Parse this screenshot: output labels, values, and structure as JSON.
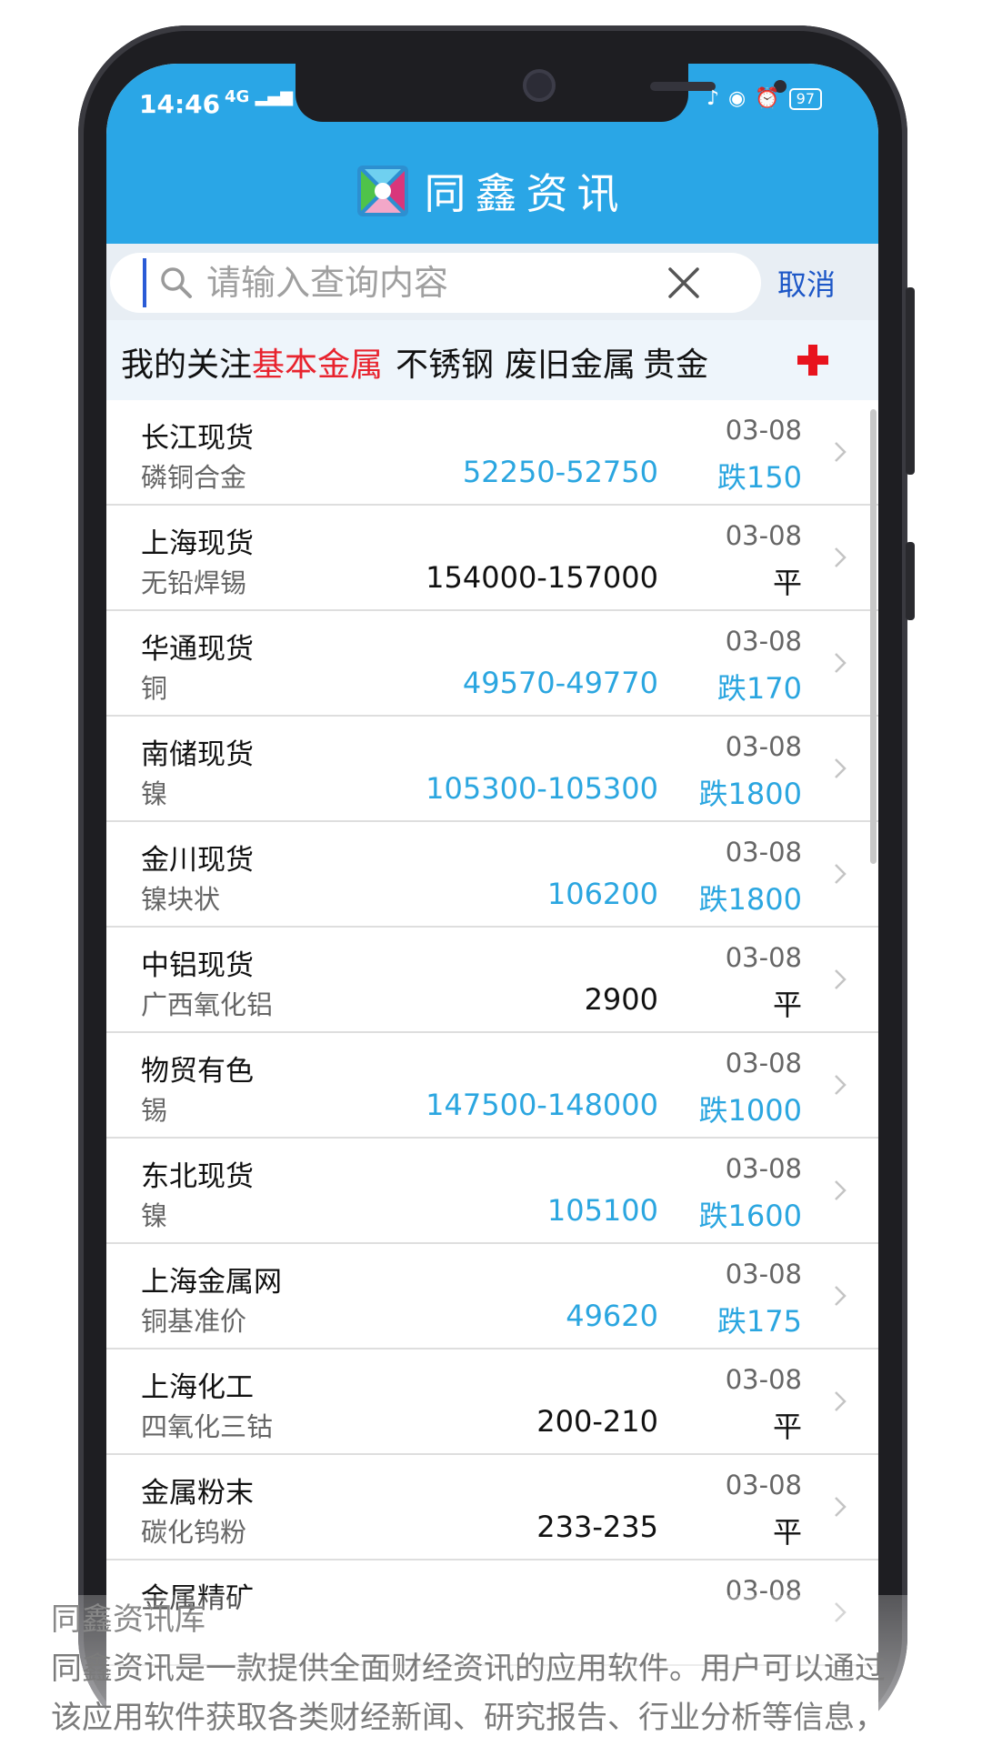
{
  "status": {
    "time": "14:46",
    "network": "4G",
    "battery": "97"
  },
  "app": {
    "title": "同鑫资讯"
  },
  "search": {
    "placeholder": "请输入查询内容",
    "cancel_label": "取消"
  },
  "tabs": [
    {
      "label": "我的关注",
      "active": false
    },
    {
      "label": "基本金属",
      "active": true
    },
    {
      "label": "不锈钢",
      "active": false
    },
    {
      "label": "废旧金属",
      "active": false
    },
    {
      "label": "贵金",
      "active": false
    }
  ],
  "rows": [
    {
      "source": "长江现货",
      "product": "磷铜合金",
      "date": "03-08",
      "price": "52250-52750",
      "change": "跌150",
      "trend": "down"
    },
    {
      "source": "上海现货",
      "product": "无铅焊锡",
      "date": "03-08",
      "price": "154000-157000",
      "change": "平",
      "trend": "flat"
    },
    {
      "source": "华通现货",
      "product": "铜",
      "date": "03-08",
      "price": "49570-49770",
      "change": "跌170",
      "trend": "down"
    },
    {
      "source": "南储现货",
      "product": "镍",
      "date": "03-08",
      "price": "105300-105300",
      "change": "跌1800",
      "trend": "down"
    },
    {
      "source": "金川现货",
      "product": "镍块状",
      "date": "03-08",
      "price": "106200",
      "change": "跌1800",
      "trend": "down"
    },
    {
      "source": "中铝现货",
      "product": "广西氧化铝",
      "date": "03-08",
      "price": "2900",
      "change": "平",
      "trend": "flat"
    },
    {
      "source": "物贸有色",
      "product": "锡",
      "date": "03-08",
      "price": "147500-148000",
      "change": "跌1000",
      "trend": "down"
    },
    {
      "source": "东北现货",
      "product": "镍",
      "date": "03-08",
      "price": "105100",
      "change": "跌1600",
      "trend": "down"
    },
    {
      "source": "上海金属网",
      "product": "铜基准价",
      "date": "03-08",
      "price": "49620",
      "change": "跌175",
      "trend": "down"
    },
    {
      "source": "上海化工",
      "product": "四氧化三钴",
      "date": "03-08",
      "price": "200-210",
      "change": "平",
      "trend": "flat"
    },
    {
      "source": "金属粉末",
      "product": "碳化钨粉",
      "date": "03-08",
      "price": "233-235",
      "change": "平",
      "trend": "flat"
    },
    {
      "source": "金属精矿",
      "product": "",
      "date": "03-08",
      "price": "",
      "change": "",
      "trend": "flat"
    }
  ],
  "caption": {
    "title": "同鑫资讯库",
    "line1": "同鑫资讯是一款提供全面财经资讯的应用软件。用户可以通过",
    "line2": "该应用软件获取各类财经新闻、研究报告、行业分析等信息，"
  },
  "colors": {
    "header": "#2aa6e6",
    "active_tab": "#e8232e",
    "down": "#2ba6e0",
    "flat": "#111111",
    "cancel": "#1d57c7"
  }
}
